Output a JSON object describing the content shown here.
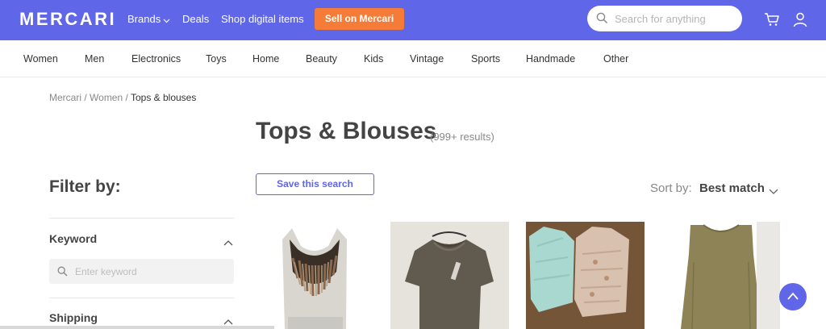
{
  "header": {
    "logo": "MERCARI",
    "nav": [
      "Brands",
      "Deals",
      "Shop digital items"
    ],
    "sell_label": "Sell on Mercari",
    "search_placeholder": "Search for anything",
    "brand_color": "#5f66e8",
    "sell_color": "#f47c38"
  },
  "categories": [
    "Women",
    "Men",
    "Electronics",
    "Toys",
    "Home",
    "Beauty",
    "Kids",
    "Vintage",
    "Sports",
    "Handmade",
    "Other"
  ],
  "breadcrumb": {
    "items": [
      "Mercari",
      "Women",
      "Tops & blouses"
    ],
    "separator": " / "
  },
  "page": {
    "title": "Tops & Blouses",
    "results": "(999+ results)"
  },
  "filter": {
    "title": "Filter by:",
    "sections": [
      "Keyword",
      "Shipping"
    ],
    "keyword_placeholder": "Enter keyword"
  },
  "save_search_label": "Save this search",
  "sort": {
    "label": "Sort by:",
    "value": "Best match"
  },
  "products": [
    {
      "image": "fringe-halter-top"
    },
    {
      "image": "olive-ruffle-neck-tee"
    },
    {
      "image": "mint-and-floral-blouses"
    },
    {
      "image": "olive-sleeveless-top"
    }
  ]
}
